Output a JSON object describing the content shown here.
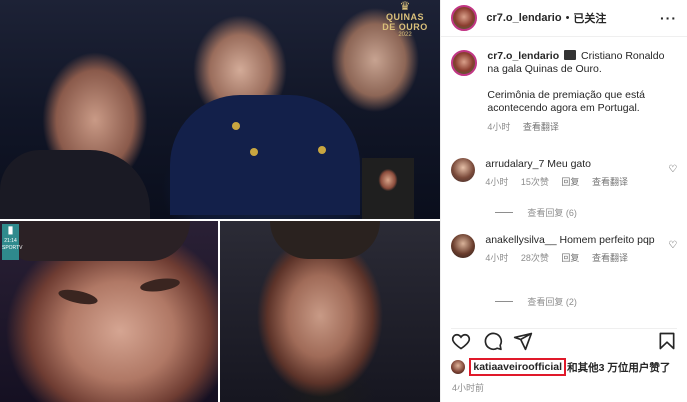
{
  "post": {
    "logo": {
      "line1": "QUINAS",
      "line2": "DE OURO",
      "year": "2022"
    },
    "tv_badge": {
      "label1": "21:14",
      "label2": "SPORTV"
    }
  },
  "header": {
    "username": "cr7.o_lendario",
    "separator": "•",
    "follow_status": "已关注",
    "more": "···"
  },
  "caption": {
    "username": "cr7.o_lendario",
    "text_part1": "Cristiano Ronaldo na gala Quinas de Ouro.",
    "text_part2": "Cerimônia de premiação que está acontecendo agora em Portugal.",
    "time": "4小时",
    "translate": "查看翻译"
  },
  "comments": [
    {
      "username": "arrudalary_7",
      "text": "Meu gato",
      "time": "4小时",
      "likes": "15次赞",
      "reply": "回复",
      "translate": "查看翻译",
      "view_replies": "查看回复 (6)"
    },
    {
      "username": "anakellysilva__",
      "text": "Homem perfeito pqp",
      "time": "4小时",
      "likes": "28次赞",
      "reply": "回复",
      "translate": "查看翻译",
      "view_replies": "查看回复 (2)"
    }
  ],
  "likes": {
    "first_user": "katiaaveiroofficial",
    "rest": "和其他3 万位用户赞了"
  },
  "post_time": "4小时前",
  "icons": [
    "heart-icon",
    "comment-icon",
    "share-icon",
    "bookmark-icon"
  ],
  "colors": {
    "highlight_box": "#e0192a",
    "story_ring": "#c13584",
    "muted": "#8e8e8e"
  }
}
